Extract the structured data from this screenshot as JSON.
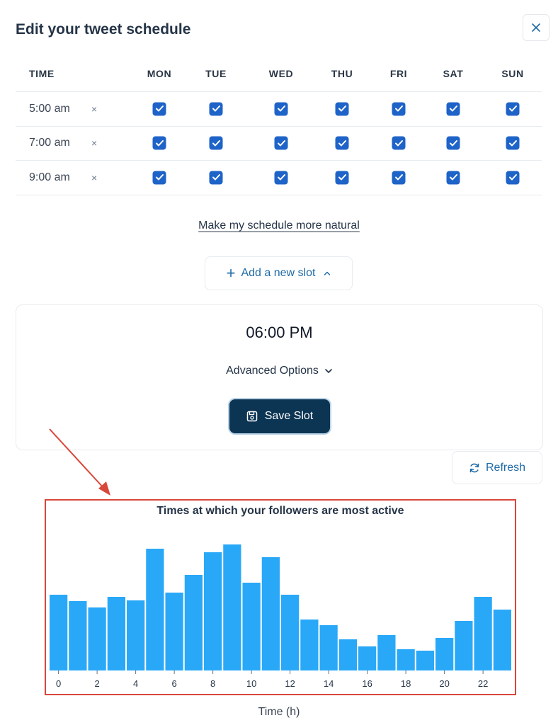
{
  "header": {
    "title": "Edit your tweet schedule"
  },
  "schedule": {
    "time_label": "TIME",
    "days": [
      "MON",
      "TUE",
      "WED",
      "THU",
      "FRI",
      "SAT",
      "SUN"
    ],
    "rows": [
      {
        "time": "5:00 am",
        "remove": "×"
      },
      {
        "time": "7:00 am",
        "remove": "×"
      },
      {
        "time": "9:00 am",
        "remove": "×"
      }
    ],
    "all_checked": true
  },
  "natural_link": "Make my schedule more natural",
  "add_slot": {
    "label": "Add a new slot",
    "plus": "+",
    "caret": "˄"
  },
  "slot_editor": {
    "time": "06:00 PM",
    "advanced_label": "Advanced Options",
    "save_label": "Save Slot"
  },
  "refresh_label": "Refresh",
  "colors": {
    "accent": "#1e63c8",
    "bar": "#29a8f8",
    "annotation": "#d9463a",
    "primary_button": "#0c3453"
  },
  "chart_data": {
    "type": "bar",
    "title": "Times at which your followers are most active",
    "xlabel": "Time (h)",
    "ylabel": "",
    "x": [
      0,
      1,
      2,
      3,
      4,
      5,
      6,
      7,
      8,
      9,
      10,
      11,
      12,
      13,
      14,
      15,
      16,
      17,
      18,
      19,
      20,
      21,
      22,
      23
    ],
    "values": [
      107,
      98,
      89,
      104,
      99,
      172,
      110,
      135,
      167,
      178,
      124,
      160,
      107,
      72,
      64,
      44,
      34,
      50,
      30,
      28,
      46,
      70,
      104,
      86
    ],
    "x_ticks": [
      "0",
      "2",
      "4",
      "6",
      "8",
      "10",
      "12",
      "14",
      "16",
      "18",
      "20",
      "22"
    ],
    "ylim": [
      0,
      200
    ],
    "grid": false,
    "legend": "none"
  }
}
